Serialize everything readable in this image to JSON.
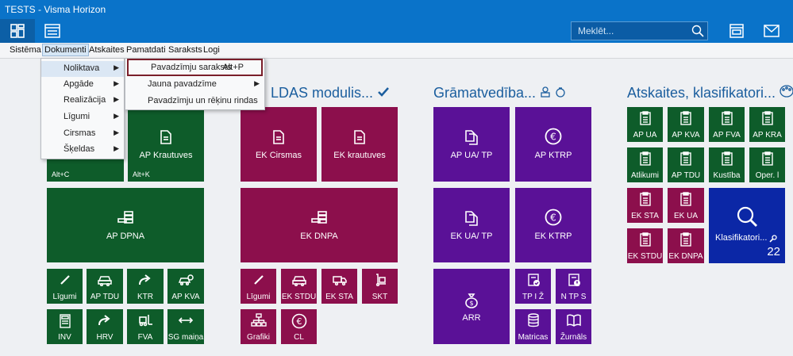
{
  "window": {
    "title": "TESTS - Visma Horizon"
  },
  "search": {
    "placeholder": "Meklēt..."
  },
  "menu": [
    "Sistēma",
    "Dokumenti",
    "Atskaites",
    "Pamatdati",
    "Saraksts",
    "Logi"
  ],
  "dropdown": [
    "Noliktava",
    "Apgāde",
    "Realizācija",
    "Līgumi",
    "Cirsmas",
    "Šķeldas"
  ],
  "submenu": [
    {
      "label": "Pavadzīmju saraksts",
      "shortcut": "Alt+P"
    },
    {
      "label": "Jauna pavadzīme",
      "shortcut": ""
    },
    {
      "label": "Pavadzīmju un rēķinu rindas",
      "shortcut": ""
    }
  ],
  "sections": {
    "middle_title": "LDAS modulis...",
    "gramat_title": "Grāmatvedība...",
    "atskaites_title": "Atskaites, klasifikatori..."
  },
  "tiles": {
    "apk_shortcut": "Alt+C",
    "ap_krautuves": "AP Krautuves",
    "ap_krautuves_shortcut": "Alt+K",
    "ap_dpna": "AP DPNA",
    "ligumi": "Līgumi",
    "ap_tdu": "AP TDU",
    "ktr": "KTR",
    "ap_kva": "AP KVA",
    "inv": "INV",
    "hrv": "HRV",
    "fva": "FVA",
    "sg_maina": "SG maiņa",
    "ek_cirsmas": "EK Cirsmas",
    "ek_krautuves": "EK krautuves",
    "ek_dnpa": "EK DNPA",
    "ek_ligumi": "Līgumi",
    "ek_stdu": "EK STDU",
    "ek_sta": "EK STA",
    "skt": "SKT",
    "grafiki": "Grafiki",
    "cl": "CL",
    "ap_ua_tp": "AP UA/ TP",
    "ap_ktrp": "AP KTRP",
    "ek_ua_tp": "EK UA/ TP",
    "ek_ktrp": "EK KTRP",
    "arr": "ARR",
    "tp_iz": "TP I Ž",
    "n_tp_s": "N TP S",
    "matricas": "Matricas",
    "zurnals": "Žurnāls",
    "r_ap_ua": "AP UA",
    "r_ap_kva": "AP KVA",
    "r_ap_fva": "AP FVA",
    "r_ap_kra": "AP KRA",
    "r_atlikumi": "Atlikumi",
    "r_ap_tdu": "AP TDU",
    "r_kustiba": "Kustība",
    "r_oper": "Oper. l",
    "r_ek_sta": "EK STA",
    "r_ek_ua": "EK UA",
    "r_ek_stdu": "EK STDU",
    "r_ek_dnpa": "EK DNPA",
    "klasifikatori": "Klasifikatori...",
    "klasifikatori_count": "22"
  }
}
